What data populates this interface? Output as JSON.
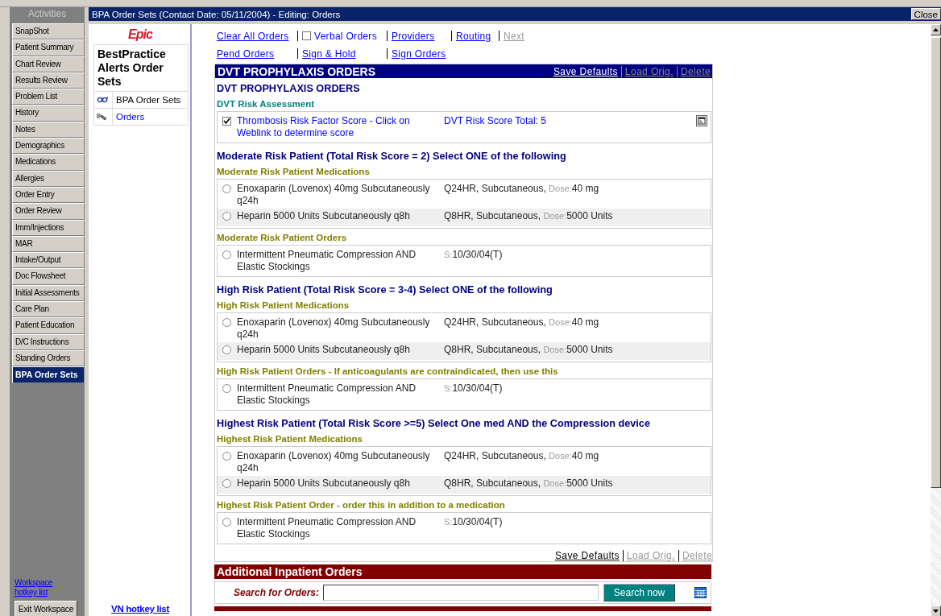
{
  "window": {
    "title": "BPA Order Sets (Contact Date: 05/11/2004) - Editing: Orders",
    "close_button": "Close"
  },
  "activities": {
    "title": "Activities",
    "items": [
      {
        "label": "SnapShot",
        "selected": false
      },
      {
        "label": "Patient Summary",
        "selected": false
      },
      {
        "label": "Chart Review",
        "selected": false
      },
      {
        "label": "Results Review",
        "selected": false
      },
      {
        "label": "Problem List",
        "selected": false
      },
      {
        "label": "History",
        "selected": false
      },
      {
        "label": "Notes",
        "selected": false
      },
      {
        "label": "Demographics",
        "selected": false
      },
      {
        "label": "Medications",
        "selected": false
      },
      {
        "label": "Allergies",
        "selected": false
      },
      {
        "label": "Order Entry",
        "selected": false
      },
      {
        "label": "Order Review",
        "selected": false
      },
      {
        "label": "Imm/Injections",
        "selected": false
      },
      {
        "label": "MAR",
        "selected": false
      },
      {
        "label": "Intake/Output",
        "selected": false
      },
      {
        "label": "Doc Flowsheet",
        "selected": false
      },
      {
        "label": "Initial Assessments",
        "selected": false
      },
      {
        "label": "Care Plan",
        "selected": false
      },
      {
        "label": "Patient Education",
        "selected": false
      },
      {
        "label": "D/C Instructions",
        "selected": false
      },
      {
        "label": "Standing Orders",
        "selected": false
      },
      {
        "label": "BPA Order Sets",
        "selected": true
      }
    ],
    "hotkey_link": "Workspace hotkey list",
    "exit_button": "Exit Workspace"
  },
  "navigator": {
    "logo": "Epic",
    "heading": "BestPractice Alerts Order Sets",
    "items": [
      {
        "label": "BPA Order Sets",
        "kind": "plain"
      },
      {
        "label": "Orders",
        "kind": "link"
      }
    ],
    "hotkey_link": "VN hotkey list"
  },
  "toolbar": {
    "rows": [
      {
        "items": [
          {
            "kind": "link",
            "label": "Clear All Orders",
            "disabled": false
          },
          {
            "kind": "checkbox",
            "label": "Verbal Orders",
            "checked": false
          },
          {
            "kind": "link",
            "label": "Providers",
            "disabled": false
          },
          {
            "kind": "link",
            "label": "Routing",
            "disabled": false
          },
          {
            "kind": "link",
            "label": "Next",
            "disabled": true
          }
        ]
      },
      {
        "items": [
          {
            "kind": "link",
            "label": "Pend Orders",
            "disabled": false
          },
          {
            "kind": "link",
            "label": "Sign & Hold",
            "disabled": false
          },
          {
            "kind": "link",
            "label": "Sign Orders",
            "disabled": false
          }
        ]
      }
    ]
  },
  "order_set": {
    "title": "DVT PROPHYLAXIS ORDERS",
    "actions": [
      {
        "label": "Save Defaults",
        "disabled": false
      },
      {
        "label": "Load Orig.",
        "disabled": true
      },
      {
        "label": "Delete",
        "disabled": true
      }
    ],
    "sections": [
      {
        "title": "DVT PROPHYLAXIS ORDERS",
        "groups": [
          {
            "title": "DVT Risk Assessment",
            "kind": "assessment",
            "rows": [
              {
                "kind": "checkbox",
                "checked": true,
                "label": "Thrombosis Risk Factor Score - Click on Weblink to determine score",
                "detail": "DVT Risk Score Total: 5"
              }
            ]
          }
        ]
      },
      {
        "title": "Moderate Risk Patient (Total Risk Score = 2) Select ONE of the following",
        "groups": [
          {
            "title": "Moderate Risk Patient Medications",
            "kind": "orders",
            "rows": [
              {
                "kind": "radio",
                "selected": false,
                "label": "Enoxaparin (Lovenox) 40mg Subcutaneously q24h",
                "detail": "Q24HR, Subcutaneous,",
                "field_label": "Dose:",
                "field_value": "40 mg"
              },
              {
                "kind": "radio",
                "selected": false,
                "label": "Heparin 5000 Units Subcutaneously q8h",
                "detail": "Q8HR, Subcutaneous,",
                "field_label": "Dose:",
                "field_value": "5000 Units"
              }
            ]
          },
          {
            "title": "Moderate Risk Patient Orders",
            "kind": "orders",
            "rows": [
              {
                "kind": "radio",
                "selected": false,
                "label": "Intermittent Pneumatic Compression AND Elastic Stockings",
                "field_label": "S:",
                "field_value": "10/30/04(T)"
              }
            ]
          }
        ]
      },
      {
        "title": "High Risk Patient (Total Risk Score = 3-4) Select ONE of the following",
        "groups": [
          {
            "title": "High Risk Patient Medications",
            "kind": "orders",
            "rows": [
              {
                "kind": "radio",
                "selected": false,
                "label": "Enoxaparin (Lovenox) 40mg Subcutaneously q24h",
                "detail": "Q24HR, Subcutaneous,",
                "field_label": "Dose:",
                "field_value": "40 mg"
              },
              {
                "kind": "radio",
                "selected": false,
                "label": "Heparin 5000 Units Subcutaneously q8h",
                "detail": "Q8HR, Subcutaneous,",
                "field_label": "Dose:",
                "field_value": "5000 Units"
              }
            ]
          },
          {
            "title": "High Risk Patient Orders - If anticoagulants are contraindicated, then use this",
            "kind": "orders",
            "rows": [
              {
                "kind": "radio",
                "selected": false,
                "label": "Intermittent Pneumatic Compression AND Elastic Stockings",
                "field_label": "S:",
                "field_value": "10/30/04(T)"
              }
            ]
          }
        ]
      },
      {
        "title": "Highest Risk Patient (Total Risk Score >=5) Select One med AND the Compression device",
        "groups": [
          {
            "title": "Highest Risk Patient Medications",
            "kind": "orders",
            "rows": [
              {
                "kind": "radio",
                "selected": false,
                "label": "Enoxaparin (Lovenox) 40mg Subcutaneously q24h",
                "detail": "Q24HR, Subcutaneous,",
                "field_label": "Dose:",
                "field_value": "40 mg"
              },
              {
                "kind": "radio",
                "selected": false,
                "label": "Heparin 5000 Units Subcutaneously q8h",
                "detail": "Q8HR, Subcutaneous,",
                "field_label": "Dose:",
                "field_value": "5000 Units"
              }
            ]
          },
          {
            "title": "Highest Risk Patient Order - order this in addition to a medication",
            "kind": "orders",
            "rows": [
              {
                "kind": "radio",
                "selected": false,
                "label": "Intermittent Pneumatic Compression AND Elastic Stockings",
                "field_label": "S:",
                "field_value": "10/30/04(T)"
              }
            ]
          }
        ]
      }
    ],
    "footer_actions": [
      {
        "label": "Save Defaults",
        "disabled": false
      },
      {
        "label": "Load Orig.",
        "disabled": true
      },
      {
        "label": "Delete",
        "disabled": true
      }
    ]
  },
  "additional_orders": {
    "title": "Additional Inpatient Orders",
    "search_label": "Search for Orders:",
    "search_button": "Search now"
  }
}
